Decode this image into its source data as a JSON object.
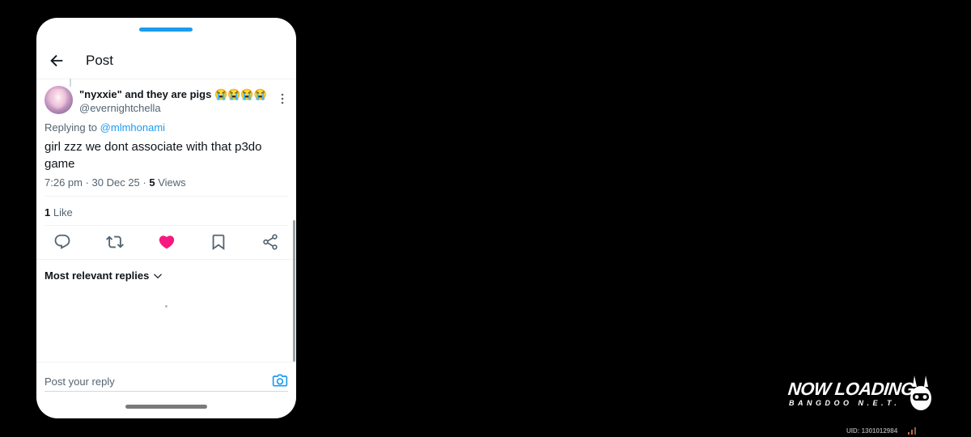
{
  "header": {
    "title": "Post",
    "back_icon": "arrow-left-icon"
  },
  "tweet": {
    "display_name": "\"nyxxie\" and they are pigs 😭😭😭😭",
    "handle": "@evernightchella",
    "replying_prefix": "Replying to",
    "replying_to": "@mlmhonami",
    "text": "girl zzz we dont associate with that p3do game",
    "time_date": "7:26 pm · 30 Dec 25 · ",
    "views_count": "5",
    "views_label": " Views",
    "likes_count": "1",
    "likes_label": " Like",
    "liked": true
  },
  "actions": [
    "reply-icon",
    "retweet-icon",
    "heart-icon",
    "bookmark-icon",
    "share-icon"
  ],
  "replies": {
    "sort_label": "Most relevant replies"
  },
  "composer": {
    "placeholder": "Post your reply"
  },
  "overlay": {
    "brand_main": "NOW LOADING",
    "brand_sub": "BANGDOO N.E.T.",
    "uid": "UID: 1301012984"
  },
  "colors": {
    "accent": "#1d9bf0",
    "like": "#f91880",
    "text": "#0f1419",
    "muted": "#536471"
  }
}
